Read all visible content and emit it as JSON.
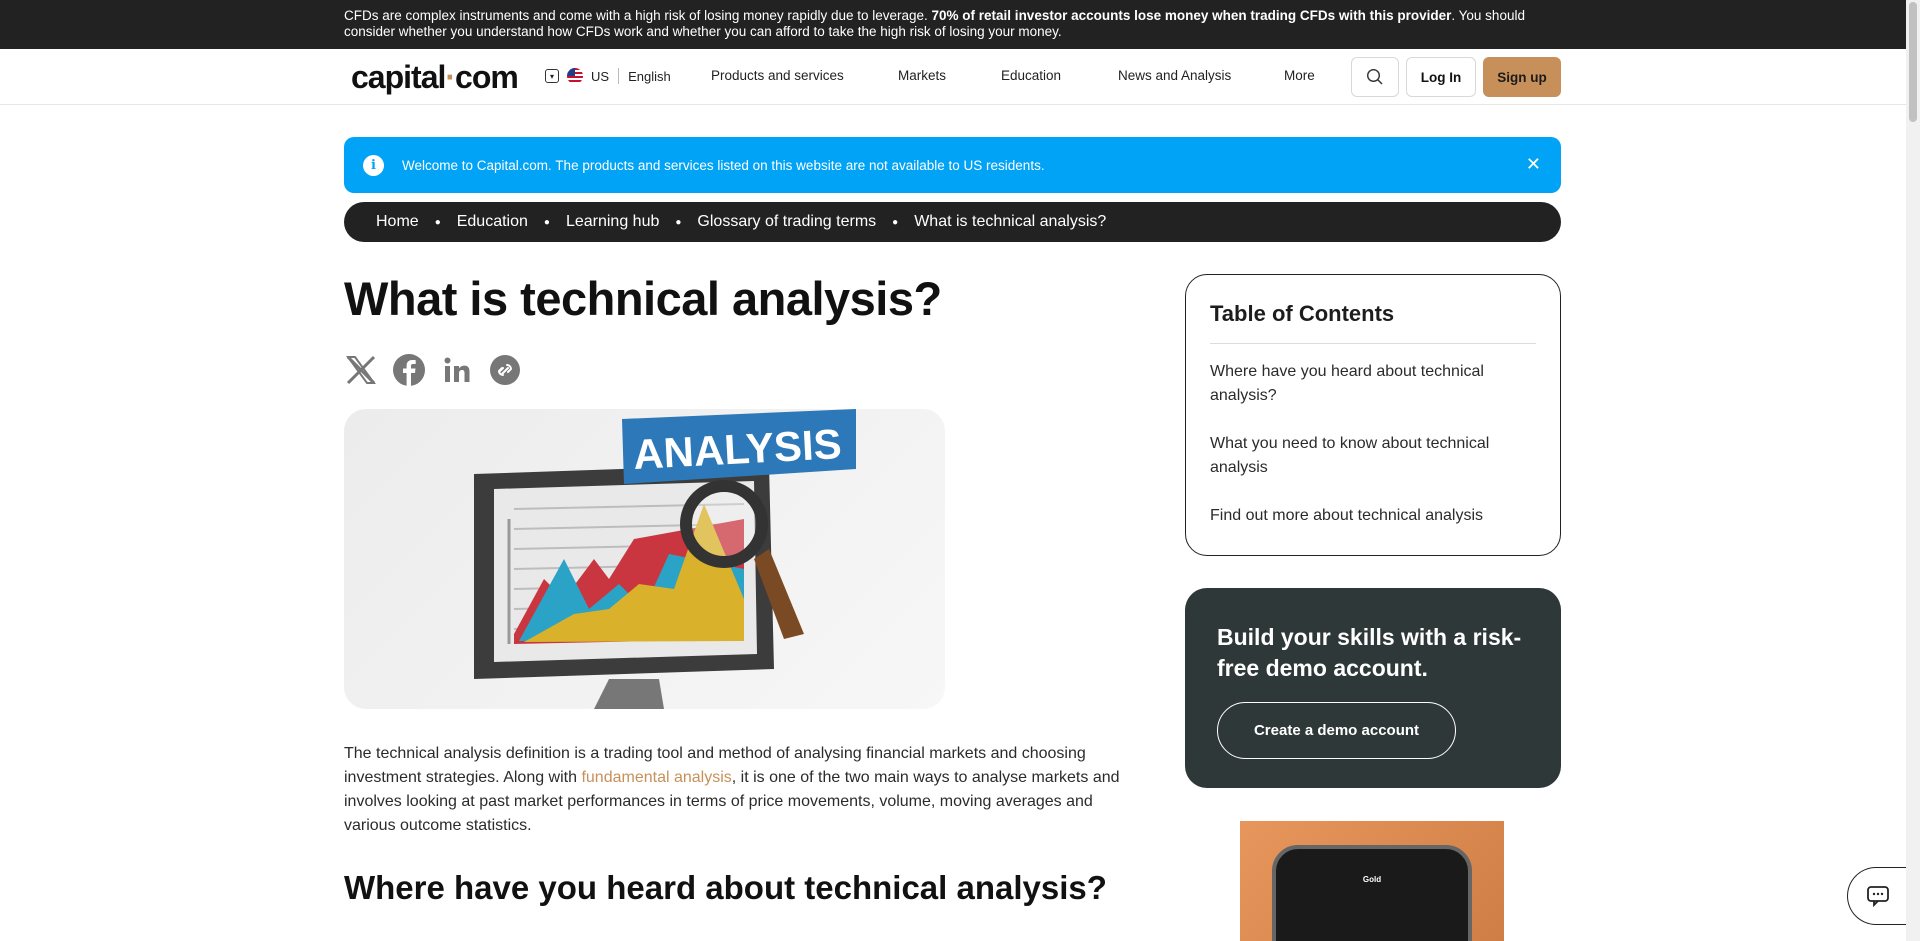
{
  "risk_banner": {
    "text_pre": "CFDs are complex instruments and come with a high risk of losing money rapidly due to leverage. ",
    "text_bold": "70% of retail investor accounts lose money when trading CFDs with this provider",
    "text_post": ". You should consider whether you understand how CFDs work and whether you can afford to take the high risk of losing your money."
  },
  "header": {
    "logo_left": "capital",
    "logo_dot": "·",
    "logo_right": "com",
    "region": "US",
    "language": "English",
    "nav": [
      "Products and services",
      "Markets",
      "Education",
      "News and Analysis",
      "More"
    ],
    "login_label": "Log In",
    "signup_label": "Sign up"
  },
  "info_bar": {
    "text": "Welcome to Capital.com. The products and services listed on this website are not available to US residents.",
    "icon_glyph": "i",
    "close_glyph": "✕"
  },
  "breadcrumb": [
    "Home",
    "Education",
    "Learning hub",
    "Glossary of trading terms",
    "What is technical analysis?"
  ],
  "article": {
    "title": "What is technical analysis?",
    "hero_label": "ANALYSIS",
    "para_pre": "The technical analysis definition is a trading tool and method of analysing financial markets and choosing investment strategies. Along with ",
    "para_link": "fundamental analysis",
    "para_post": ", it is one of the two main ways to analyse markets and involves looking at past market performances in terms of price movements, volume, moving averages and various outcome statistics.",
    "section_heading": "Where have you heard about technical analysis?"
  },
  "toc": {
    "heading": "Table of Contents",
    "items": [
      "Where have you heard about technical analysis?",
      "What you need to know about technical analysis",
      "Find out more about technical analysis"
    ]
  },
  "demo_card": {
    "title": "Build your skills with a risk-free demo account.",
    "button": "Create a demo account"
  },
  "promo": {
    "asset": "Gold"
  },
  "colors": {
    "accent": "#c7905a",
    "info_blue": "#00a3f5",
    "dark": "#222222",
    "card_dark": "#2f3838"
  }
}
